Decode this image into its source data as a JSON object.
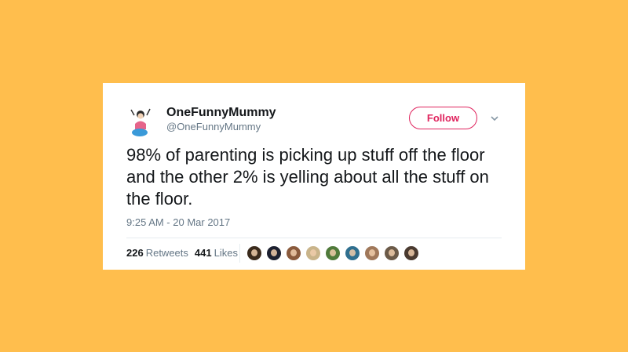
{
  "tweet": {
    "display_name": "OneFunnyMummy",
    "handle": "@OneFunnyMummy",
    "follow_label": "Follow",
    "text": "98% of parenting is picking up stuff off the floor and the other 2% is yelling about all the stuff on the floor.",
    "timestamp": "9:25 AM - 20 Mar 2017",
    "retweets_count": "226",
    "retweets_label": "Retweets",
    "likes_count": "441",
    "likes_label": "Likes"
  },
  "colors": {
    "background": "#FFBE4D",
    "card": "#FFFFFF",
    "follow_accent": "#E0245E",
    "text_primary": "#14171A",
    "text_secondary": "#657786"
  },
  "likers": [
    {
      "color": "#3a2a1c"
    },
    {
      "color": "#1c2030"
    },
    {
      "color": "#8a5a3c"
    },
    {
      "color": "#c9b48a"
    },
    {
      "color": "#4f7a3a"
    },
    {
      "color": "#2f6f8f"
    },
    {
      "color": "#a0785a"
    },
    {
      "color": "#6b5a48"
    },
    {
      "color": "#4a3a30"
    }
  ]
}
